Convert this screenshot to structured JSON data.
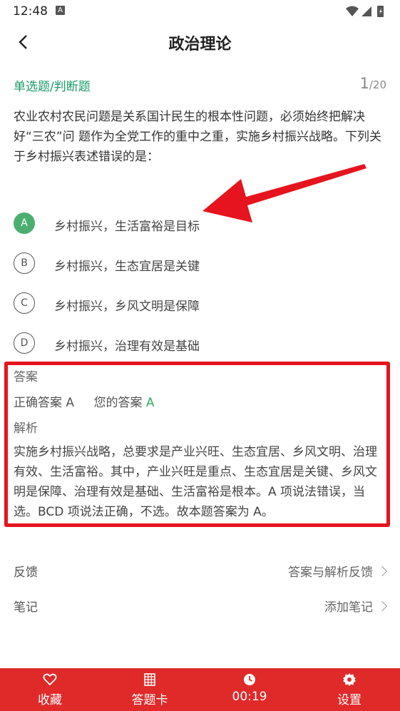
{
  "status": {
    "time": "12:48",
    "notif": "A"
  },
  "header": {
    "title": "政治理论"
  },
  "question": {
    "type": "单选题/判断题",
    "current": "1",
    "total": "/20",
    "text": "农业农村农民问题是关系国计民生的根本性问题，必须始终把解决好“三农”问 题作为全党工作的重中之重，实施乡村振兴战略。下列关于乡村振兴表述错误的是："
  },
  "options": [
    {
      "letter": "A",
      "text": "乡村振兴，生活富裕是目标",
      "correct": true
    },
    {
      "letter": "B",
      "text": "乡村振兴，生态宜居是关键",
      "correct": false
    },
    {
      "letter": "C",
      "text": "乡村振兴，乡风文明是保障",
      "correct": false
    },
    {
      "letter": "D",
      "text": "乡村振兴，治理有效是基础",
      "correct": false
    }
  ],
  "answer": {
    "label": "答案",
    "correct_label": "正确答案",
    "correct_value": "A",
    "your_label": "您的答案",
    "your_value": "A",
    "analysis_label": "解析",
    "analysis_text": "实施乡村振兴战略，总要求是产业兴旺、生态宜居、乡风文明、治理有效、生活富裕。其中，产业兴旺是重点、生态宜居是关键、乡风文明是保障、治理有效是基础、生活富裕是根本。A 项说法错误，当选。BCD 项说法正确，不选。故本题答案为 A。"
  },
  "feedback": {
    "label": "反馈",
    "action": "答案与解析反馈"
  },
  "notes": {
    "label": "笔记",
    "action": "添加笔记"
  },
  "tabs": {
    "favorite": "收藏",
    "answer_card": "答题卡",
    "timer": "00:19",
    "settings": "设置"
  },
  "colors": {
    "accent": "#1a9c68",
    "correct": "#4caf70",
    "bar": "#e02a2a",
    "highlight": "#e5141e"
  }
}
